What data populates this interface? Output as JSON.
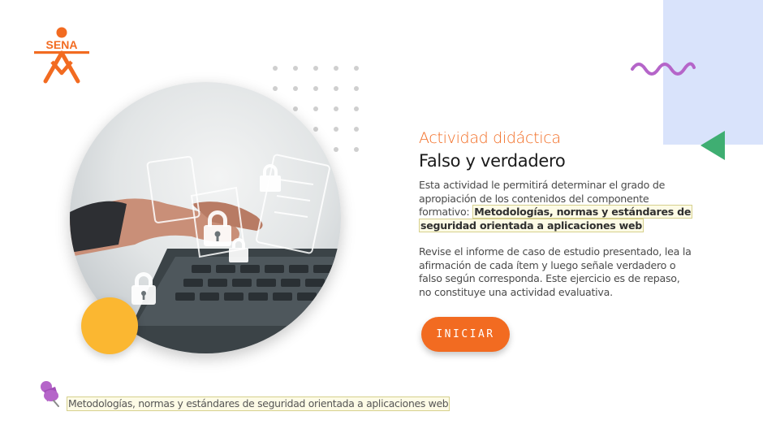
{
  "brand": {
    "logo_text": "SENA",
    "accent_color": "#f26b21"
  },
  "activity": {
    "kicker": "Actividad didáctica",
    "title": "Falso y verdadero",
    "intro": "Esta actividad le permitirá determinar el grado de apropiación de los contenidos del componente formativo:",
    "component_name": "Metodologías, normas y estándares de seguridad orientada a aplicaciones web",
    "instructions": "Revise el informe de caso de estudio presentado, lea la afirmación de cada ítem y luego señale verdadero o falso según corresponda.  Este ejercicio es de repaso, no constituye una actividad evaluativa."
  },
  "start_button": {
    "label": "INICIAR"
  },
  "footer": {
    "pin_icon": "pushpin-icon",
    "component_label": "Metodologías, normas y estándares de seguridad orientada a aplicaciones web"
  },
  "decorations": {
    "panel_color": "#d9e3fb",
    "wave_color": "#b565c9",
    "triangle_color": "#3fae72",
    "circle_color": "#fbb731"
  }
}
